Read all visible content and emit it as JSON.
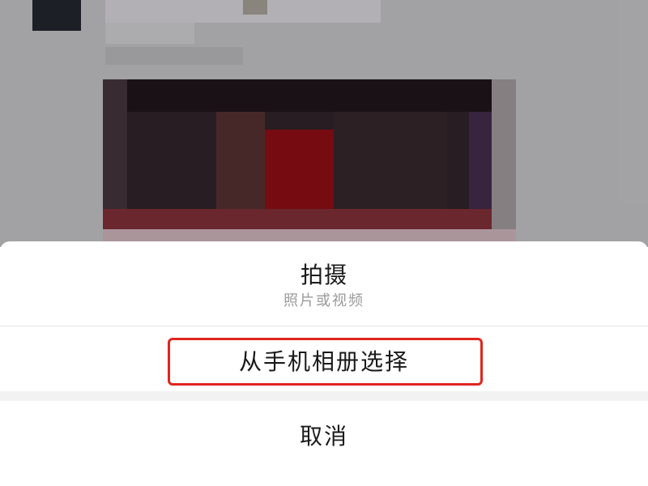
{
  "action_sheet": {
    "take_photo": {
      "title": "拍摄",
      "subtitle": "照片或视频"
    },
    "choose_from_album": {
      "label": "从手机相册选择"
    },
    "cancel": {
      "label": "取消"
    }
  },
  "colors": {
    "highlight_border": "#e0251f",
    "sheet_background": "#ffffff",
    "overlay_background": "#a8a8aa"
  }
}
